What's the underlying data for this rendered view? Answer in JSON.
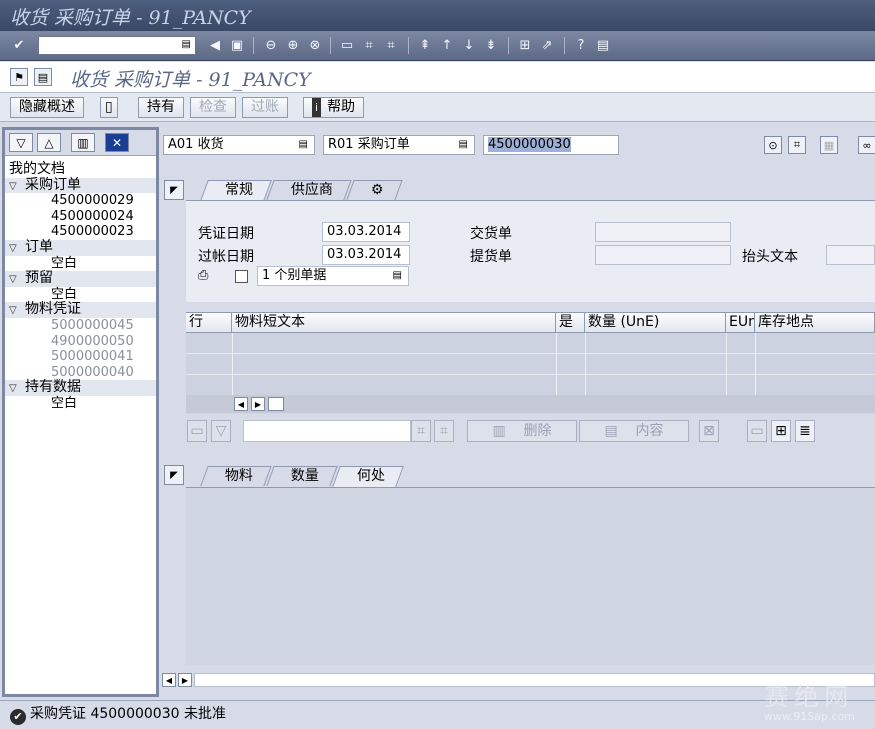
{
  "window": {
    "title": "收货 采购订单 - 91_PANCY"
  },
  "system_toolbar": {
    "command_field_value": ""
  },
  "app_title": "收货 采购订单 - 91_PANCY",
  "app_toolbar": {
    "hide_overview": "隐藏概述",
    "hold": "持有",
    "check": "检查",
    "post": "过账",
    "help": "帮助"
  },
  "left_panel": {
    "my_documents": "我的文档",
    "groups": [
      {
        "label": "采购订单",
        "items": [
          "4500000029",
          "4500000024",
          "4500000023"
        ]
      },
      {
        "label": "订单",
        "items": [
          "空白"
        ]
      },
      {
        "label": "预留",
        "items": [
          "空白"
        ]
      },
      {
        "label": "物料凭证",
        "items": [
          "5000000045",
          "4900000050",
          "5000000041",
          "5000000040"
        ]
      },
      {
        "label": "持有数据",
        "items": [
          "空白"
        ]
      }
    ]
  },
  "header": {
    "transaction": "A01 收货",
    "reference": "R01 采购订单",
    "po_number": "4500000030"
  },
  "tabs": [
    "常规",
    "供应商"
  ],
  "general": {
    "doc_date_label": "凭证日期",
    "doc_date": "03.03.2014",
    "post_date_label": "过帐日期",
    "post_date": "03.03.2014",
    "delivery_note_label": "交货单",
    "delivery_note": "",
    "bill_of_lading_label": "提货单",
    "bill_of_lading": "",
    "header_text_label": "抬头文本",
    "header_text": "",
    "print_option": "1 个别单据"
  },
  "items_table": {
    "columns": [
      "行",
      "物料短文本",
      "是",
      "数量 (UnE)",
      "EUn",
      "库存地点"
    ]
  },
  "item_buttons": {
    "delete": "删除",
    "content": "内容"
  },
  "detail_tabs": [
    "物料",
    "数量",
    "何处"
  ],
  "status": {
    "message": "采购凭证 4500000030 未批准"
  },
  "watermark": {
    "text": "赛绝网",
    "url": "www.91Sap.com"
  }
}
